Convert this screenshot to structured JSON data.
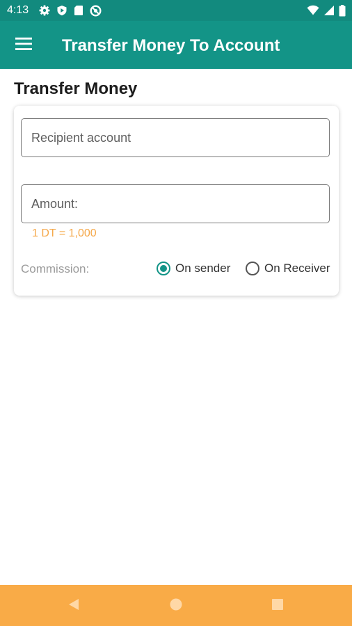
{
  "status_bar": {
    "time": "4:13",
    "left_icons": [
      "settings-icon",
      "shield-play-icon",
      "sd-card-icon",
      "data-saver-icon"
    ],
    "right_icons": [
      "wifi-icon",
      "cell-signal-icon",
      "battery-icon"
    ]
  },
  "app_bar": {
    "menu_icon": "hamburger-menu-icon",
    "title": "Transfer Money To Account"
  },
  "page": {
    "heading": "Transfer Money"
  },
  "form": {
    "recipient": {
      "placeholder": "Recipient account",
      "value": ""
    },
    "amount": {
      "placeholder": "Amount:",
      "value": ""
    },
    "rate_hint": "1 DT = 1,000",
    "commission": {
      "label": "Commission:",
      "options": [
        {
          "label": "On sender",
          "selected": true
        },
        {
          "label": "On Receiver",
          "selected": false
        }
      ]
    }
  },
  "nav_bar": {
    "buttons": [
      "back-icon",
      "home-icon",
      "recents-icon"
    ]
  },
  "colors": {
    "status_bar": "#128a7e",
    "app_bar": "#139487",
    "accent": "#139487",
    "rate_hint": "#f5a84a",
    "nav_bar": "#f9ab47"
  }
}
